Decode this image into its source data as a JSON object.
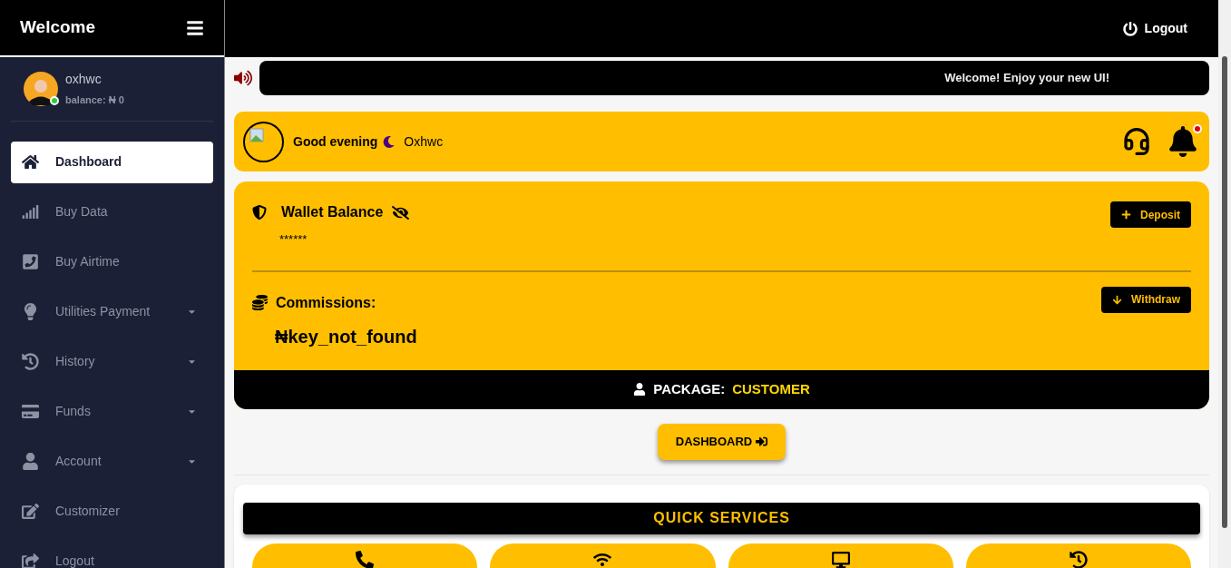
{
  "sidebar": {
    "title": "Welcome",
    "user": {
      "name": "oxhwc",
      "balance": "balance: ₦ 0",
      "online": true
    },
    "items": [
      {
        "label": "Dashboard",
        "selected": true,
        "has_submenu": false
      },
      {
        "label": "Buy Data",
        "selected": false,
        "has_submenu": false
      },
      {
        "label": "Buy Airtime",
        "selected": false,
        "has_submenu": false
      },
      {
        "label": "Utilities Payment",
        "selected": false,
        "has_submenu": true
      },
      {
        "label": "History",
        "selected": false,
        "has_submenu": true
      },
      {
        "label": "Funds",
        "selected": false,
        "has_submenu": true
      },
      {
        "label": "Account",
        "selected": false,
        "has_submenu": true
      },
      {
        "label": "Customizer",
        "selected": false,
        "has_submenu": false
      },
      {
        "label": "Logout",
        "selected": false,
        "has_submenu": false
      }
    ]
  },
  "topbar": {
    "logout": "Logout"
  },
  "announcement": "Welcome! Enjoy your new UI!",
  "greeting": {
    "text": "Good evening",
    "name": "Oxhwc",
    "notification": true
  },
  "wallet": {
    "title": "Wallet Balance",
    "balance": "******",
    "deposit": "Deposit",
    "commissions_label": "Commissions:",
    "commissions": "₦key_not_found",
    "withdraw": "Withdraw",
    "package_label": "PACKAGE:",
    "package": "CUSTOMER"
  },
  "dashboard_button": "DASHBOARD",
  "quick_services": {
    "title": "QUICK SERVICES",
    "tiles": [
      {
        "kind": "phone"
      },
      {
        "kind": "wifi"
      },
      {
        "kind": "desktop"
      },
      {
        "kind": "history"
      }
    ]
  }
}
